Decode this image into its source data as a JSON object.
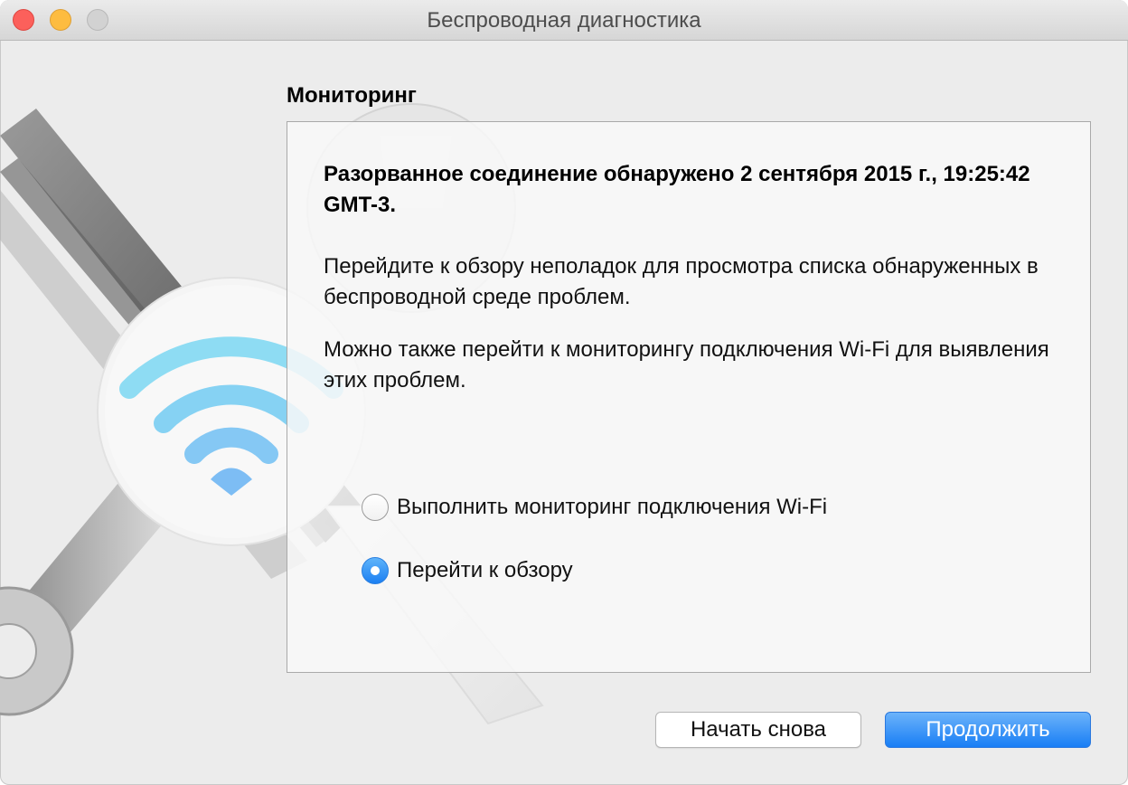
{
  "window": {
    "title": "Беспроводная диагностика"
  },
  "section": {
    "heading": "Мониторинг"
  },
  "panel": {
    "bold_message": "Разорванное соединение обнаружено 2 сентября 2015 г., 19:25:42 GMT-3.",
    "message1": "Перейдите к обзору неполадок для просмотра списка обнаруженных в беспроводной среде проблем.",
    "message2": "Можно также перейти к мониторингу подключения Wi‑Fi для выявления этих проблем.",
    "options": [
      {
        "label": "Выполнить мониторинг подключения Wi‑Fi",
        "selected": false
      },
      {
        "label": "Перейти к обзору",
        "selected": true
      }
    ]
  },
  "buttons": {
    "restart": "Начать снова",
    "continue": "Продолжить"
  },
  "icons": {
    "illustration": "wireless-diagnostics-wrench-screwdriver-wifi-icon"
  },
  "colors": {
    "accent": "#1b7ff2",
    "window_bg": "#ececec",
    "wifi_arc": "#7fd6f2"
  }
}
